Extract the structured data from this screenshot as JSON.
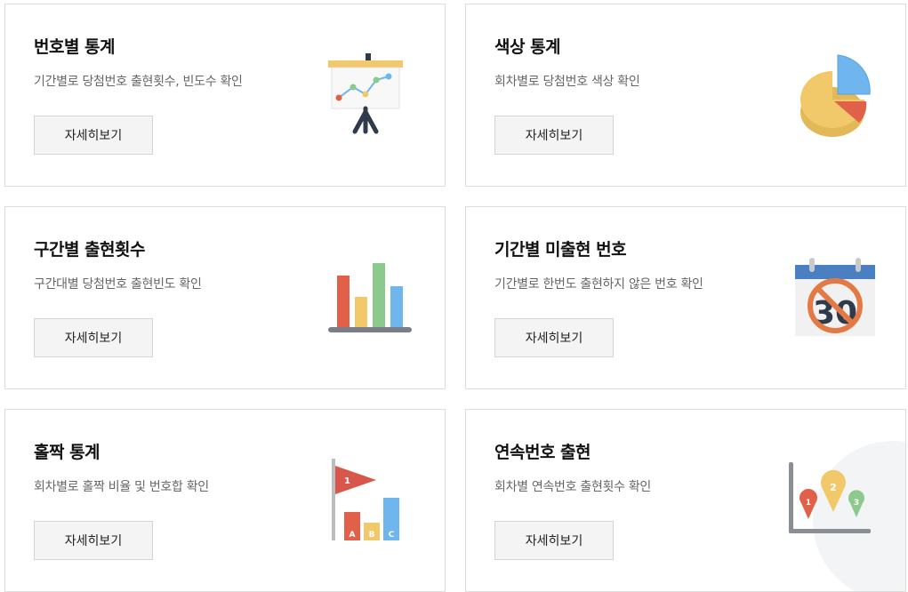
{
  "cards": [
    {
      "title": "번호별 통계",
      "desc": "기간별로 당첨번호 출현횟수, 빈도수 확인",
      "button": "자세히보기",
      "icon": "presentation-chart-icon"
    },
    {
      "title": "색상 통계",
      "desc": "회차별로 당첨번호 색상 확인",
      "button": "자세히보기",
      "icon": "pie-chart-icon"
    },
    {
      "title": "구간별 출현횟수",
      "desc": "구간대별 당첨번호 출현빈도 확인",
      "button": "자세히보기",
      "icon": "bar-chart-icon"
    },
    {
      "title": "기간별 미출현 번호",
      "desc": "기간별로 한번도 출현하지 않은 번호 확인",
      "button": "자세히보기",
      "icon": "calendar-no-30-icon",
      "icon_text": "30"
    },
    {
      "title": "홀짝 통계",
      "desc": "회차별로 홀짝 비율 및 번호합 확인",
      "button": "자세히보기",
      "icon": "flag-bars-icon",
      "icon_labels": [
        "1",
        "A",
        "B",
        "C"
      ]
    },
    {
      "title": "연속번호 출현",
      "desc": "회차별 연속번호 출현횟수 확인",
      "button": "자세히보기",
      "icon": "map-pins-chart-icon",
      "icon_labels": [
        "1",
        "2",
        "3"
      ]
    }
  ],
  "colors": {
    "red": "#e0604a",
    "yellow": "#f2c96a",
    "green": "#8cc98c",
    "blue": "#6fb6ee",
    "dark": "#2f3a4a"
  }
}
